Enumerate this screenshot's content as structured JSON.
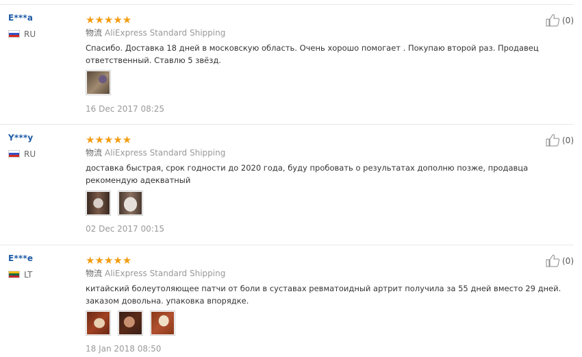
{
  "reviews": [
    {
      "user": "E***a",
      "country": "RU",
      "flag": "ru",
      "rating": 5,
      "stars": "★★★★★",
      "shipping_label": "物流",
      "shipping_method": "AliExpress Standard Shipping",
      "text": "Спасибо. Доставка 18 дней в московскую область. Очень хорошо помогает . Покупаю второй раз. Продавец ответственный. Ставлю 5 звёзд.",
      "photos": [
        {
          "colors": [
            "#5a4a3a",
            "#a08a70",
            "#6b5a80"
          ]
        }
      ],
      "date": "16 Dec 2017 08:25",
      "helpful_count": "(0)"
    },
    {
      "user": "Y***y",
      "country": "RU",
      "flag": "ru",
      "rating": 5,
      "stars": "★★★★★",
      "shipping_label": "物流",
      "shipping_method": "AliExpress Standard Shipping",
      "text": "доставка быстрая, срок годности до 2020 года, буду пробовать о результатах дополню позже, продавца рекомендую адекватный",
      "photos": [
        {
          "colors": [
            "#3a2a22",
            "#d8d0c8",
            "#7a5a48"
          ]
        },
        {
          "colors": [
            "#4a3a30",
            "#e6e0da",
            "#8a7060"
          ]
        }
      ],
      "date": "02 Dec 2017 00:15",
      "helpful_count": "(0)"
    },
    {
      "user": "E***e",
      "country": "LT",
      "flag": "lt",
      "rating": 5,
      "stars": "★★★★★",
      "shipping_label": "物流",
      "shipping_method": "AliExpress Standard Shipping",
      "text": "китайский болеутоляющее патчи от боли в суставах ревматоидный артрит получила за 55 дней вместо 29 дней. заказом довольна. упаковка впорядке.",
      "photos": [
        {
          "colors": [
            "#6a2a18",
            "#e8d0b0",
            "#a04020"
          ]
        },
        {
          "colors": [
            "#5a2a18",
            "#c89070",
            "#3a2018"
          ]
        },
        {
          "colors": [
            "#8a3a1a",
            "#f0e0c8",
            "#b05030"
          ]
        }
      ],
      "date": "18 Jan 2018 08:50",
      "helpful_count": "(0)"
    }
  ]
}
